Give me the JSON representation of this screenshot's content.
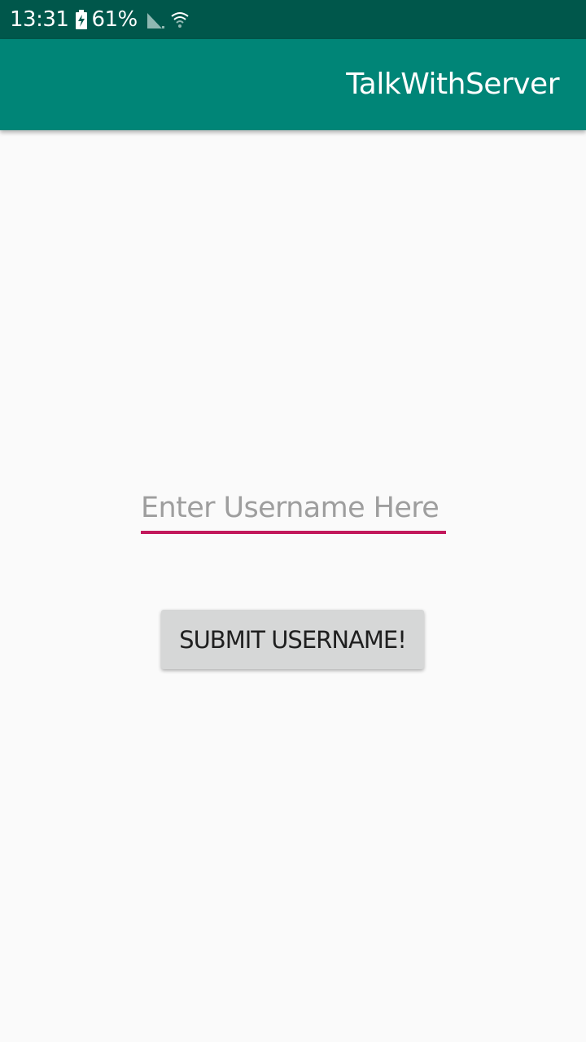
{
  "status_bar": {
    "time": "13:31",
    "battery_percent": "61%",
    "battery_icon": "battery-charging-icon",
    "signal_icon": "cell-signal-icon",
    "wifi_icon": "wifi-icon"
  },
  "app_bar": {
    "title": "TalkWithServer"
  },
  "form": {
    "username_value": "",
    "username_placeholder": "Enter Username Here",
    "submit_label": "SUBMIT USERNAME!"
  },
  "colors": {
    "status_bar": "#00574b",
    "app_bar": "#008577",
    "accent_underline": "#c2185b",
    "button_bg": "#d6d7d7",
    "background": "#fafafa"
  }
}
